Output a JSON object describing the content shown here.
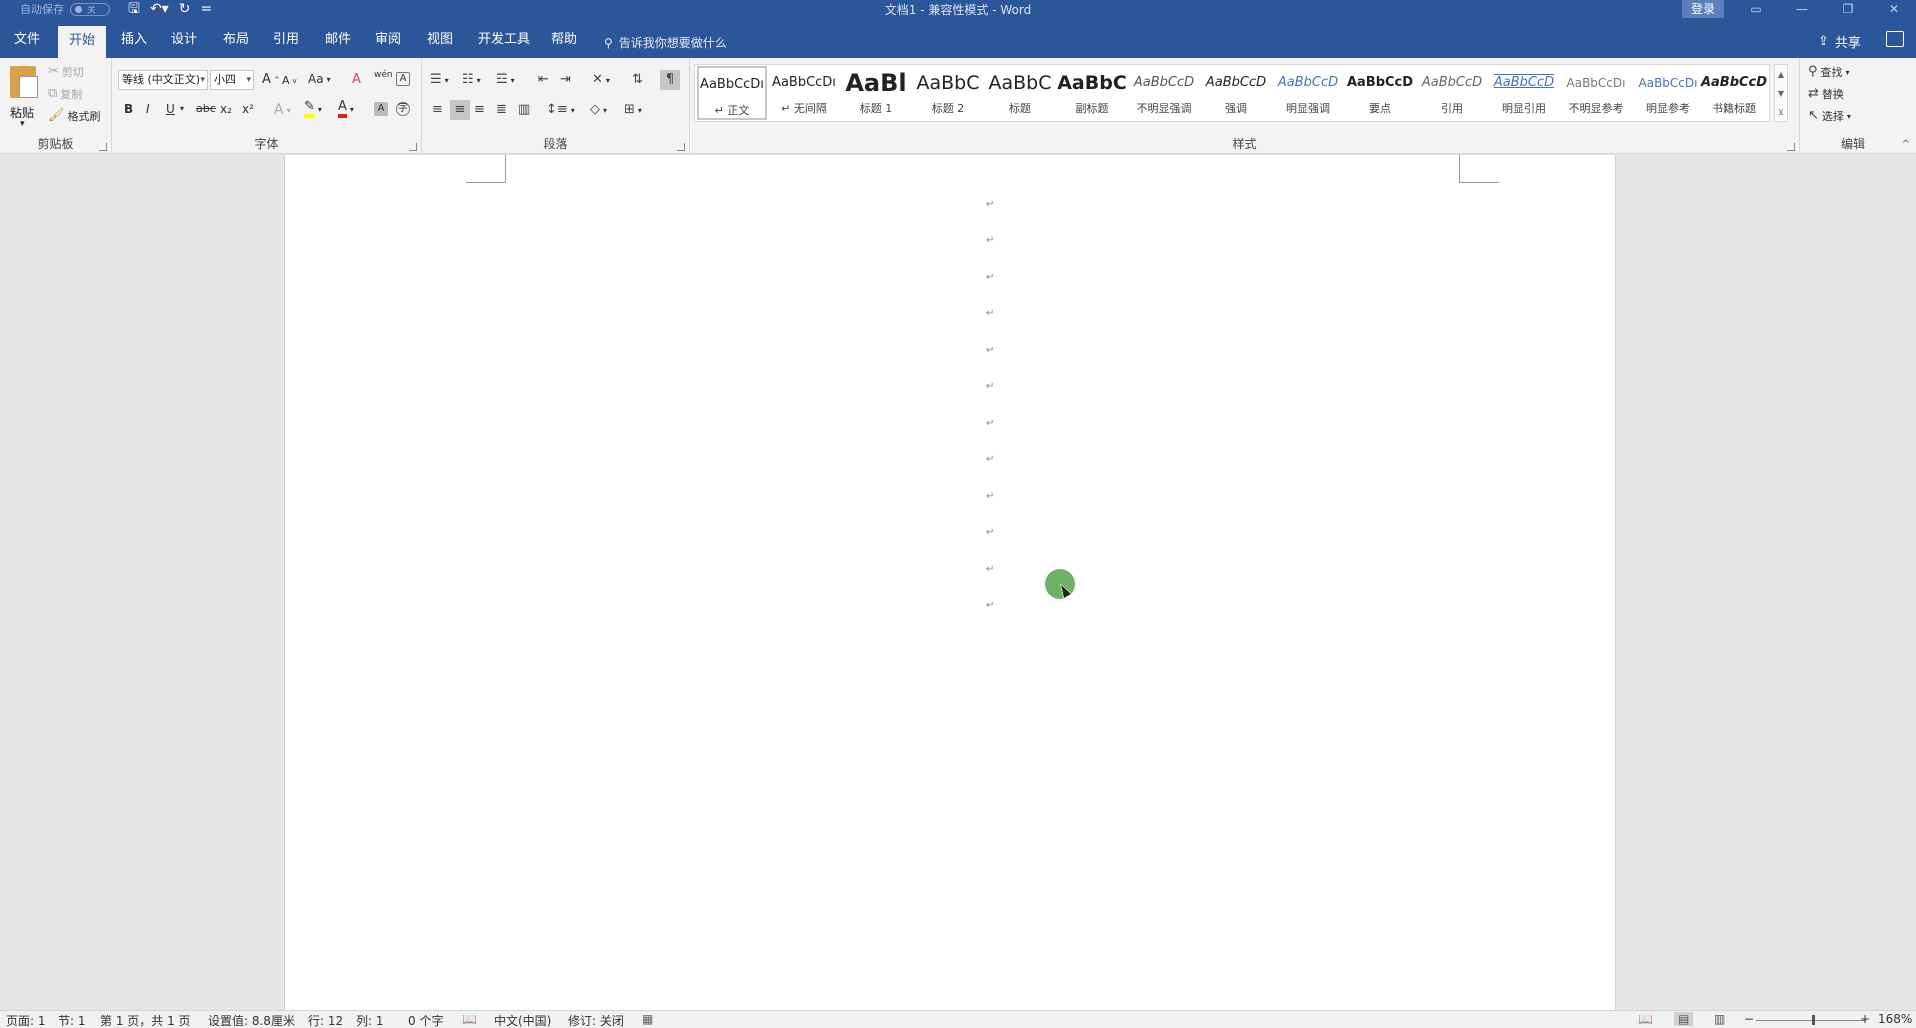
{
  "titlebar": {
    "autosave_label": "自动保存",
    "autosave_state": "关",
    "doc_title": "文档1  -  兼容性模式  -  Word",
    "login": "登录",
    "qat_more": "="
  },
  "tabs": [
    "文件",
    "开始",
    "插入",
    "设计",
    "布局",
    "引用",
    "邮件",
    "审阅",
    "视图",
    "开发工具",
    "帮助"
  ],
  "active_tab": "开始",
  "tellme": "告诉我你想要做什么",
  "share": "共享",
  "clipboard": {
    "paste": "粘贴",
    "cut": "剪切",
    "copy": "复制",
    "format_painter": "格式刷",
    "label": "剪贴板"
  },
  "font": {
    "family": "等线 (中文正文)",
    "size": "小四",
    "grow": "A",
    "shrink": "A",
    "case": "Aa",
    "wen": "wén",
    "bold": "B",
    "italic": "I",
    "underline": "U",
    "strike": "abc",
    "sub": "x₂",
    "sup": "x²",
    "label": "字体"
  },
  "paragraph": {
    "label": "段落"
  },
  "styles": {
    "label": "样式",
    "items": [
      {
        "sample": "AaBbCcDı",
        "name": "正文",
        "prefix": "↵"
      },
      {
        "sample": "AaBbCcDı",
        "name": "无间隔",
        "prefix": "↵"
      },
      {
        "sample": "AaBl",
        "name": "标题 1",
        "prefix": ""
      },
      {
        "sample": "AaBbC",
        "name": "标题 2",
        "prefix": ""
      },
      {
        "sample": "AaBbC",
        "name": "标题",
        "prefix": ""
      },
      {
        "sample": "AaBbC",
        "name": "副标题",
        "prefix": ""
      },
      {
        "sample": "AaBbCcD",
        "name": "不明显强调",
        "prefix": ""
      },
      {
        "sample": "AaBbCcD",
        "name": "强调",
        "prefix": ""
      },
      {
        "sample": "AaBbCcD",
        "name": "明显强调",
        "prefix": ""
      },
      {
        "sample": "AaBbCcD",
        "name": "要点",
        "prefix": ""
      },
      {
        "sample": "AaBbCcD",
        "name": "引用",
        "prefix": ""
      },
      {
        "sample": "AaBbCcD",
        "name": "明显引用",
        "prefix": ""
      },
      {
        "sample": "AaBbCcDı",
        "name": "不明显参考",
        "prefix": ""
      },
      {
        "sample": "AaBbCcDı",
        "name": "明显参考",
        "prefix": ""
      },
      {
        "sample": "AaBbCcD",
        "name": "书籍标题",
        "prefix": ""
      }
    ]
  },
  "editing": {
    "find": "查找",
    "replace": "替换",
    "select": "选择",
    "label": "编辑"
  },
  "document": {
    "paragraph_mark": "↵"
  },
  "statusbar": {
    "page": "页面: 1",
    "section": "节: 1",
    "page_count": "第 1 页，共 1 页",
    "at": "设置值: 8.8厘米",
    "line": "行: 12",
    "col": "列: 1",
    "words": "0 个字",
    "lang": "中文(中国)",
    "track": "修订: 关闭",
    "zoom_minus": "−",
    "zoom_plus": "+",
    "zoom": "168%"
  },
  "colors": {
    "brand": "#2b579a",
    "highlight": "#ffff00",
    "font_color": "#e02020",
    "cursor": "#5eaa57"
  }
}
